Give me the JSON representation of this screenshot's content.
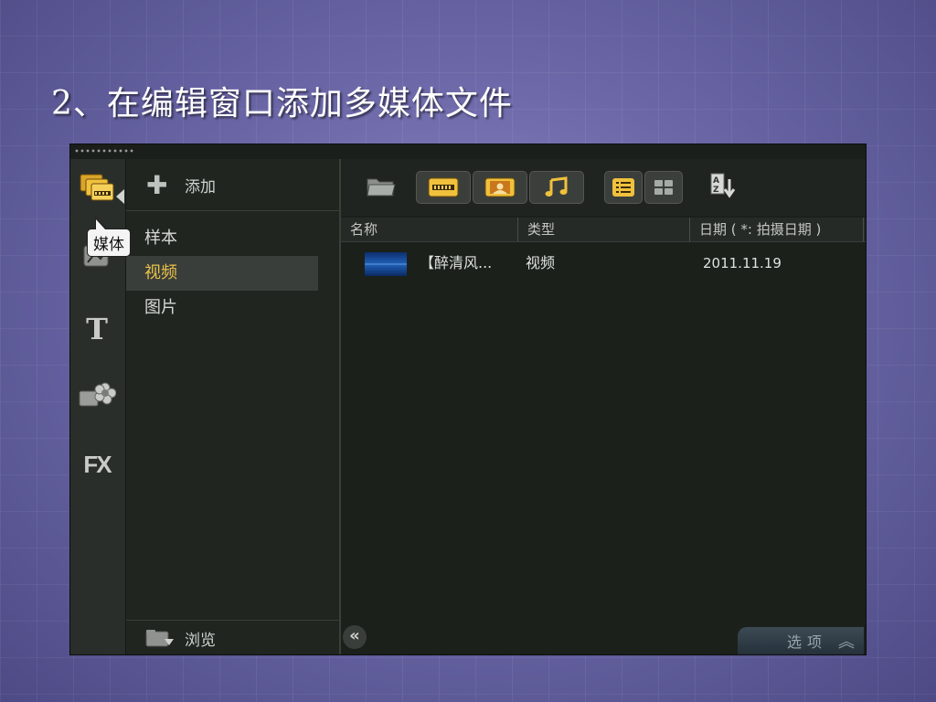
{
  "slide": {
    "title": "2、在编辑窗口添加多媒体文件"
  },
  "tooltip": {
    "text": "媒体"
  },
  "library": {
    "add_label": "添加",
    "items": [
      {
        "label": "样本",
        "selected": false
      },
      {
        "label": "视频",
        "selected": true
      },
      {
        "label": "图片",
        "selected": false
      }
    ],
    "browse_label": "浏览"
  },
  "rail": {
    "fx_label": "FX",
    "title_label": "T"
  },
  "columns": {
    "name": "名称",
    "type": "类型",
    "date": "日期 ( *: 拍摄日期 )"
  },
  "files": [
    {
      "name": "【醉清风...",
      "type": "视频",
      "date": "2011.11.19"
    }
  ],
  "bottom": {
    "collapse_label": "«",
    "options_label": "选项",
    "options_chevron": "︽"
  },
  "colors": {
    "selected_text": "#e9c24a",
    "window_bg": "#1d221d",
    "slide_bg": "#6c68a8"
  }
}
